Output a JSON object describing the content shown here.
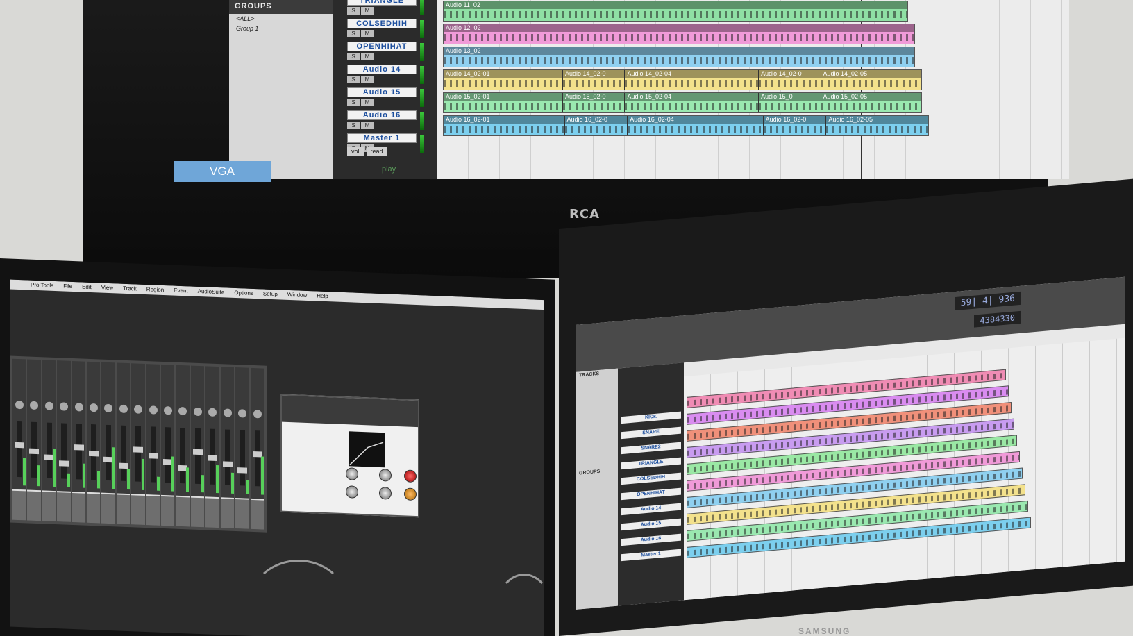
{
  "top_monitor": {
    "brand": "RCA",
    "input_label": "VGA",
    "groups_title": "GROUPS",
    "groups": [
      "<ALL>",
      "Group 1"
    ],
    "tracks": [
      "TRIANGLE",
      "COLSEDHIH",
      "OPENHIHAT",
      "Audio 14",
      "Audio 15",
      "Audio 16",
      "Master 1"
    ],
    "track_buttons": [
      "S",
      "M"
    ],
    "master_controls": [
      "vol",
      "read"
    ],
    "transport_text": "play",
    "lanes": [
      {
        "color": "#b48fe0",
        "clips": []
      },
      {
        "color": "#8fe0a4",
        "clips": [
          "Audio 11_02"
        ]
      },
      {
        "color": "#f09ad8",
        "clips": [
          "Audio 12_02"
        ]
      },
      {
        "color": "#8fd0f0",
        "clips": [
          "Audio 13_02"
        ]
      },
      {
        "color": "#f3e18c",
        "clips": [
          "Audio 14_02-01",
          "Audio 14_02-0",
          "Audio 14_02-04",
          "Audio 14_02-0",
          "Audio 14_02-05"
        ]
      },
      {
        "color": "#9ae8b0",
        "clips": [
          "Audio 15_02-01",
          "Audio 15_02-0",
          "Audio 15_02-04",
          "Audio 15_0",
          "Audio 15_02-05"
        ]
      },
      {
        "color": "#7ccfee",
        "clips": [
          "Audio 16_02-01",
          "Audio 16_02-0",
          "Audio 16_02-04",
          "Audio 16_02-0",
          "Audio 16_02-05"
        ]
      }
    ]
  },
  "bottom_left_monitor": {
    "menu": [
      "Pro Tools",
      "File",
      "Edit",
      "View",
      "Track",
      "Region",
      "Event",
      "AudioSuite",
      "Options",
      "Setup",
      "Window",
      "Help"
    ],
    "mixer_strip_count": 17
  },
  "bottom_right_monitor": {
    "brand": "SAMSUNG",
    "counter_main": "59| 4| 936",
    "counter_samples": "4384330",
    "tracks_title": "TRACKS",
    "groups_title": "GROUPS",
    "track_names": [
      "KICK",
      "SNARE",
      "SNARE2",
      "TRIANGLE",
      "COLSEDHIH",
      "OPENHIHAT",
      "Audio 14",
      "Audio 15",
      "Audio 16",
      "Master 1"
    ],
    "lane_colors": [
      "#f08cb4",
      "#d98cf0",
      "#f0907a",
      "#c89cf0",
      "#9ae8a4",
      "#f09ad8",
      "#8fd0f0",
      "#f3e18c",
      "#9ae8b0",
      "#7ccfee"
    ]
  }
}
